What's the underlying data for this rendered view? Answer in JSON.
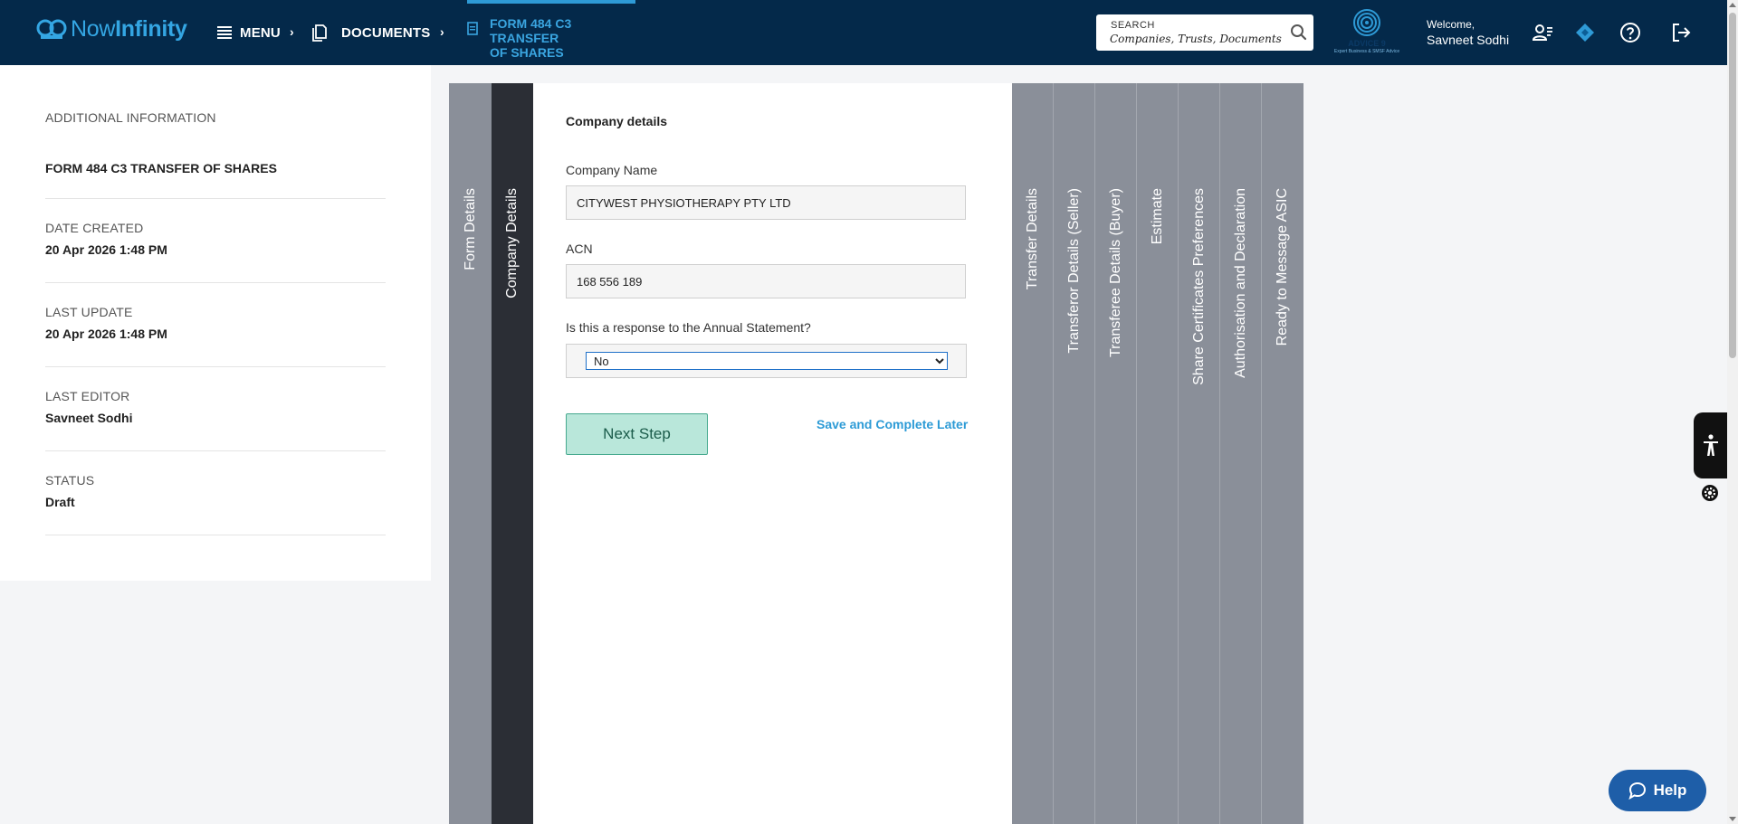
{
  "header": {
    "logo_text_a": "Now",
    "logo_text_b": "Infinity",
    "menu_label": "MENU",
    "breadcrumb_documents": "DOCUMENTS",
    "breadcrumb_current_line1": "FORM 484 C3 TRANSFER",
    "breadcrumb_current_line2": "OF SHARES",
    "search_label": "SEARCH",
    "search_placeholder": "Companies, Trusts, Documents",
    "brand_logo_text": "ADVICE 9",
    "brand_logo_tagline": "Expert Business & SMSF Advice",
    "welcome_label": "Welcome,",
    "user_name": "Savneet Sodhi"
  },
  "info_panel": {
    "heading": "ADDITIONAL INFORMATION",
    "form_name": "FORM 484 C3 TRANSFER OF SHARES",
    "date_created_label": "DATE CREATED",
    "date_created_value": "20 Apr 2026 1:48 PM",
    "last_update_label": "LAST UPDATE",
    "last_update_value": "20 Apr 2026 1:48 PM",
    "last_editor_label": "LAST EDITOR",
    "last_editor_value": "Savneet Sodhi",
    "status_label": "STATUS",
    "status_value": "Draft"
  },
  "steps": {
    "before": [
      "Form Details",
      "Company Details"
    ],
    "after": [
      "Transfer Details",
      "Transferor Details (Seller)",
      "Transferee Details (Buyer)",
      "Estimate",
      "Share Certificates Preferences",
      "Authorisation and Declaration",
      "Ready to Message ASIC"
    ]
  },
  "form": {
    "section_title": "Company details",
    "company_name_label": "Company Name",
    "company_name_value": "CITYWEST PHYSIOTHERAPY PTY LTD",
    "acn_label": "ACN",
    "acn_value": "168 556 189",
    "annual_statement_label": "Is this a response to the Annual Statement?",
    "annual_statement_value": "No",
    "next_button": "Next Step",
    "save_later_link": "Save and Complete Later"
  },
  "help_button": "Help",
  "colors": {
    "header_bg": "#04294a",
    "accent_blue": "#2e9ad6",
    "step_inactive": "#8a8f99",
    "step_active": "#2b2e35",
    "next_button_bg": "#b9e7da",
    "help_button_bg": "#1e5ea8"
  }
}
